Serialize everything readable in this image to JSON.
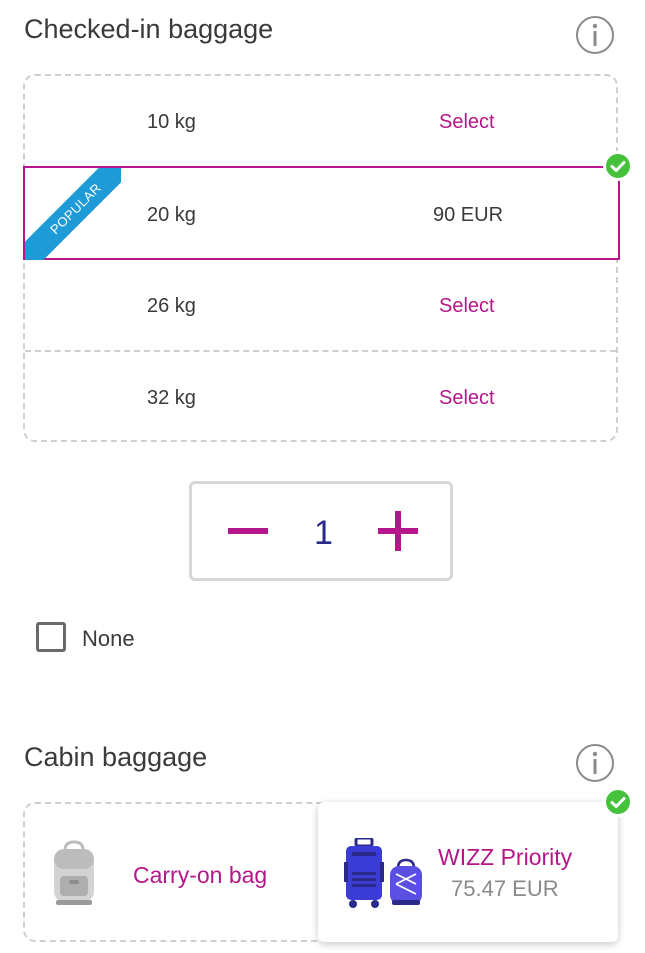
{
  "checked": {
    "title": "Checked-in baggage",
    "options": [
      {
        "weight": "10 kg",
        "action": "Select"
      },
      {
        "weight": "20 kg",
        "action": "90 EUR",
        "badge": "POPULAR",
        "selected": true
      },
      {
        "weight": "26 kg",
        "action": "Select"
      },
      {
        "weight": "32 kg",
        "action": "Select"
      }
    ],
    "quantity": "1",
    "none_label": "None"
  },
  "cabin": {
    "title": "Cabin baggage",
    "carry_on_label": "Carry-on bag",
    "priority_name": "WIZZ Priority",
    "priority_price": "75.47 EUR"
  },
  "icons": {
    "info": "info-icon",
    "check": "check-icon",
    "minus": "minus-icon",
    "plus": "plus-icon",
    "backpack": "backpack-icon",
    "luggage": "luggage-icon"
  },
  "colors": {
    "accent": "#b5178a",
    "badge": "#1e9ad6",
    "success": "#45c13b",
    "quantity": "#2a2a8a"
  }
}
